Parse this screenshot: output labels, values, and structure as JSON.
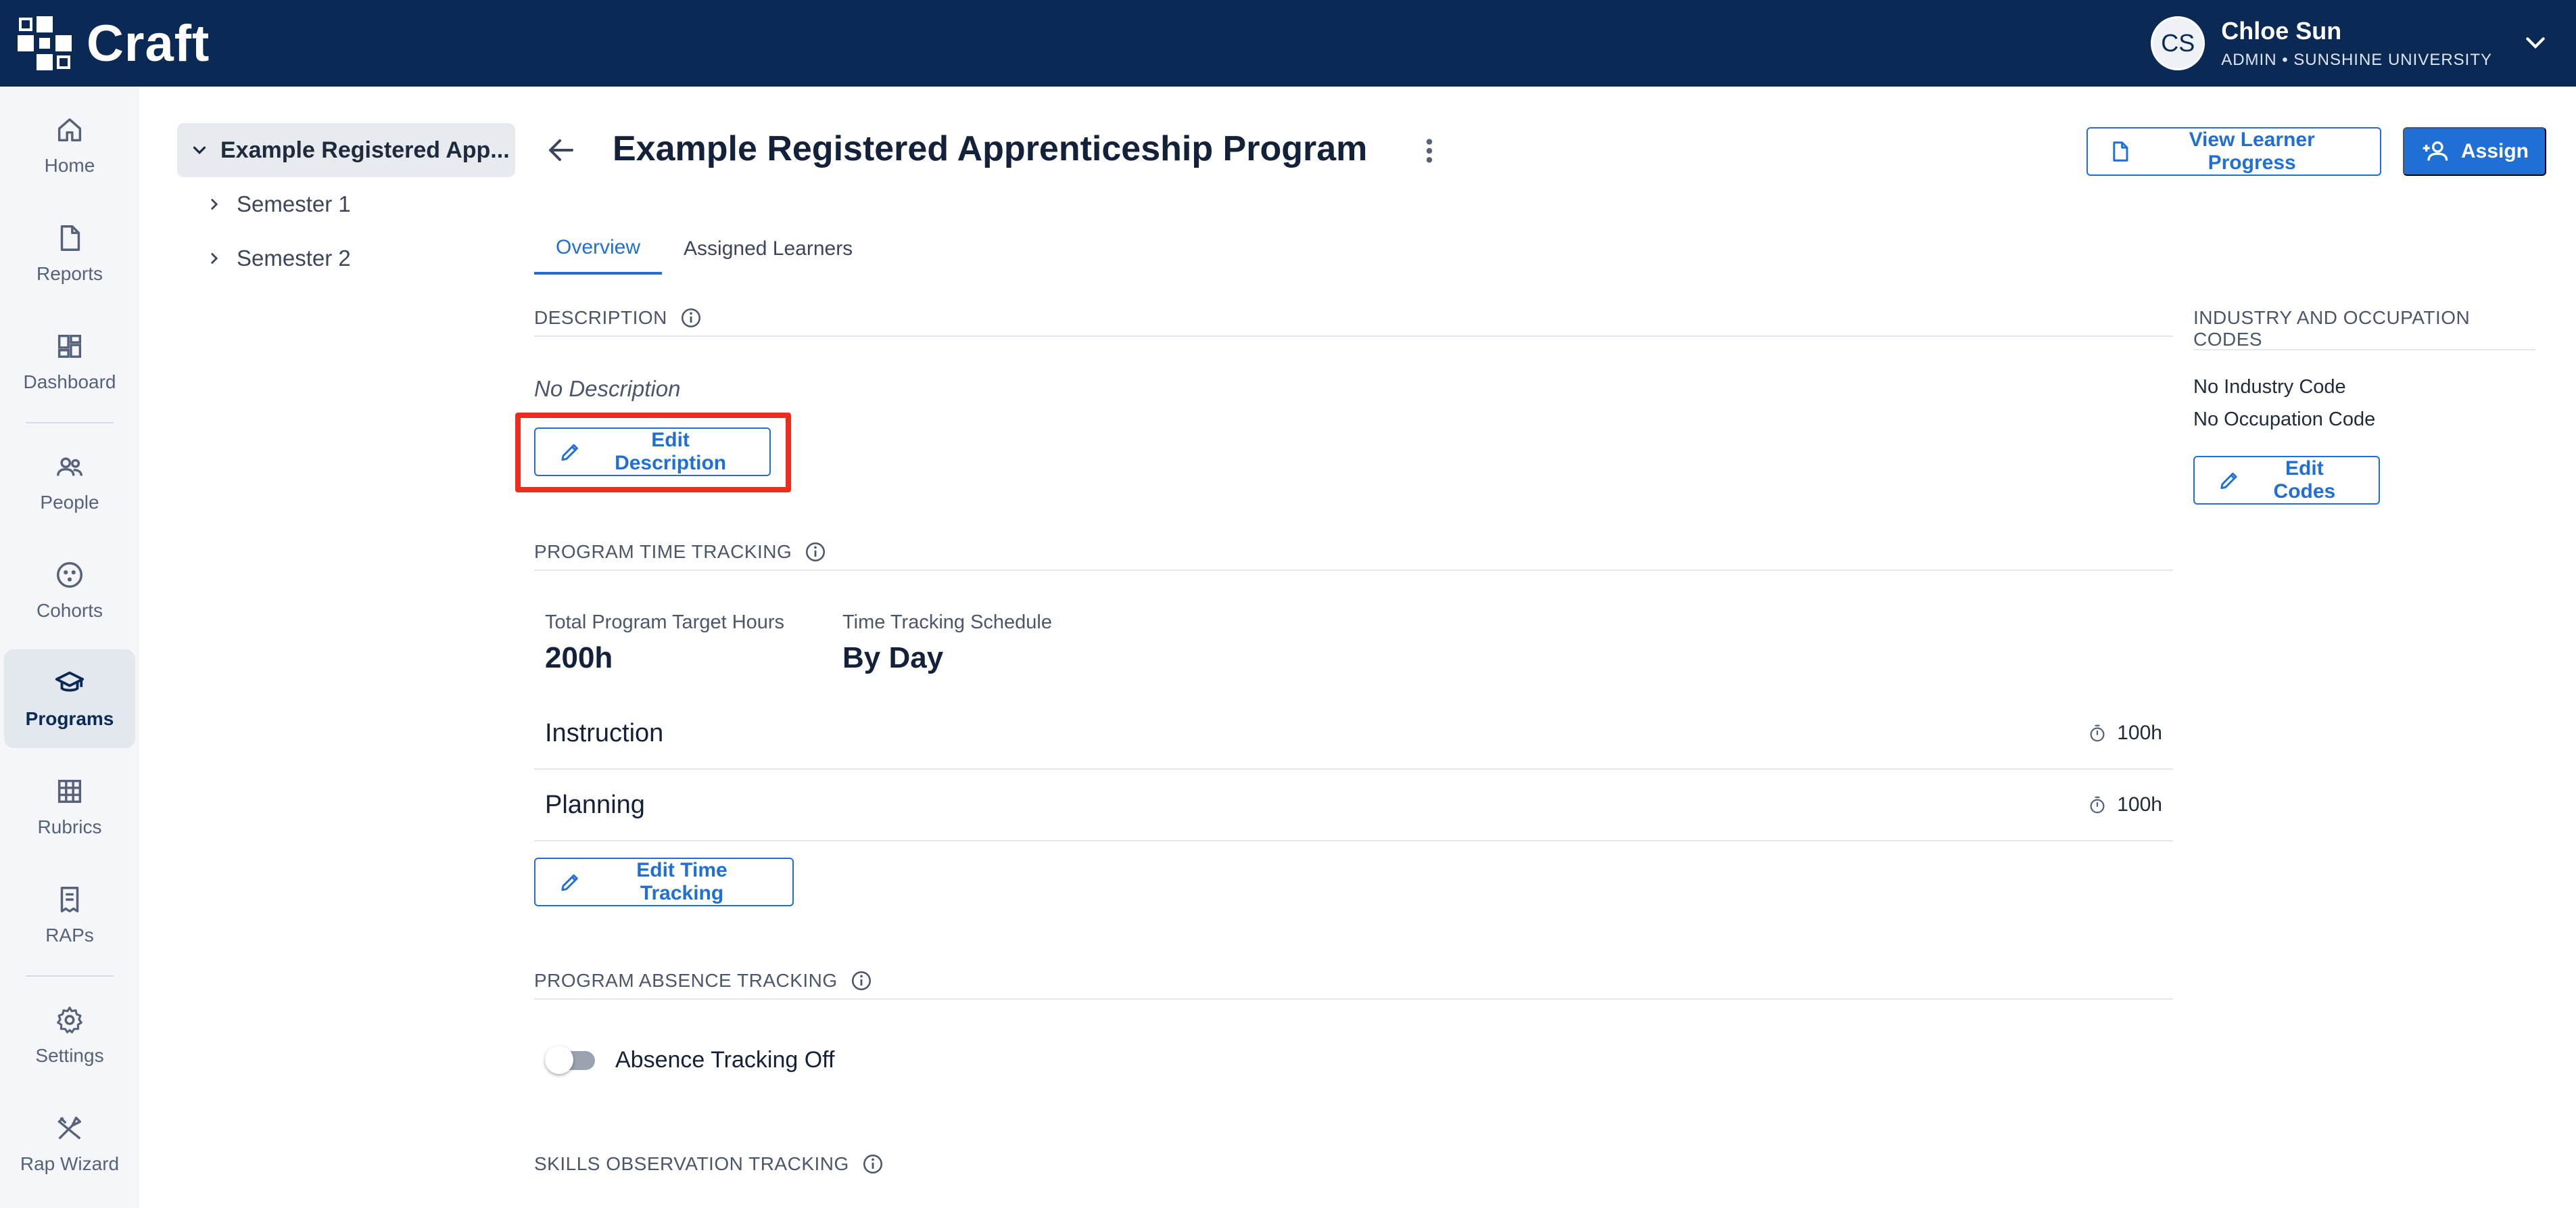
{
  "header": {
    "brand": "Craft",
    "user": {
      "initials": "CS",
      "name": "Chloe Sun",
      "role": "ADMIN • SUNSHINE UNIVERSITY"
    }
  },
  "nav": {
    "items": [
      {
        "label": "Home",
        "icon": "home-icon"
      },
      {
        "label": "Reports",
        "icon": "document-icon"
      },
      {
        "label": "Dashboard",
        "icon": "dashboard-icon"
      },
      {
        "label": "People",
        "icon": "people-icon"
      },
      {
        "label": "Cohorts",
        "icon": "cohorts-icon"
      },
      {
        "label": "Programs",
        "icon": "graduation-cap-icon",
        "active": true
      },
      {
        "label": "Rubrics",
        "icon": "grid-icon"
      },
      {
        "label": "RAPs",
        "icon": "raps-icon"
      },
      {
        "label": "Settings",
        "icon": "gear-icon"
      },
      {
        "label": "Rap Wizard",
        "icon": "tools-icon"
      }
    ]
  },
  "tree": {
    "root": "Example Registered App...",
    "children": [
      "Semester 1",
      "Semester 2"
    ]
  },
  "page": {
    "title": "Example Registered Apprenticeship Program",
    "view_progress_label": "View Learner Progress",
    "assign_label": "Assign"
  },
  "tabs": [
    {
      "label": "Overview",
      "active": true
    },
    {
      "label": "Assigned Learners",
      "active": false
    }
  ],
  "description": {
    "heading": "DESCRIPTION",
    "value": "No Description",
    "edit_label": "Edit Description"
  },
  "time_tracking": {
    "heading": "PROGRAM TIME TRACKING",
    "target_label": "Total Program Target Hours",
    "target_value": "200h",
    "schedule_label": "Time Tracking Schedule",
    "schedule_value": "By Day",
    "rows": [
      {
        "name": "Instruction",
        "hours": "100h"
      },
      {
        "name": "Planning",
        "hours": "100h"
      }
    ],
    "edit_label": "Edit Time Tracking"
  },
  "absence_tracking": {
    "heading": "PROGRAM ABSENCE TRACKING",
    "toggle_label": "Absence Tracking Off",
    "enabled": false
  },
  "skills": {
    "heading": "SKILLS OBSERVATION TRACKING"
  },
  "codes": {
    "heading": "INDUSTRY AND OCCUPATION CODES",
    "industry": "No Industry Code",
    "occupation": "No Occupation Code",
    "edit_label": "Edit Codes"
  },
  "colors": {
    "header_bg": "#0a2a55",
    "accent": "#1f6fd6",
    "highlight": "#ee2c1e"
  }
}
